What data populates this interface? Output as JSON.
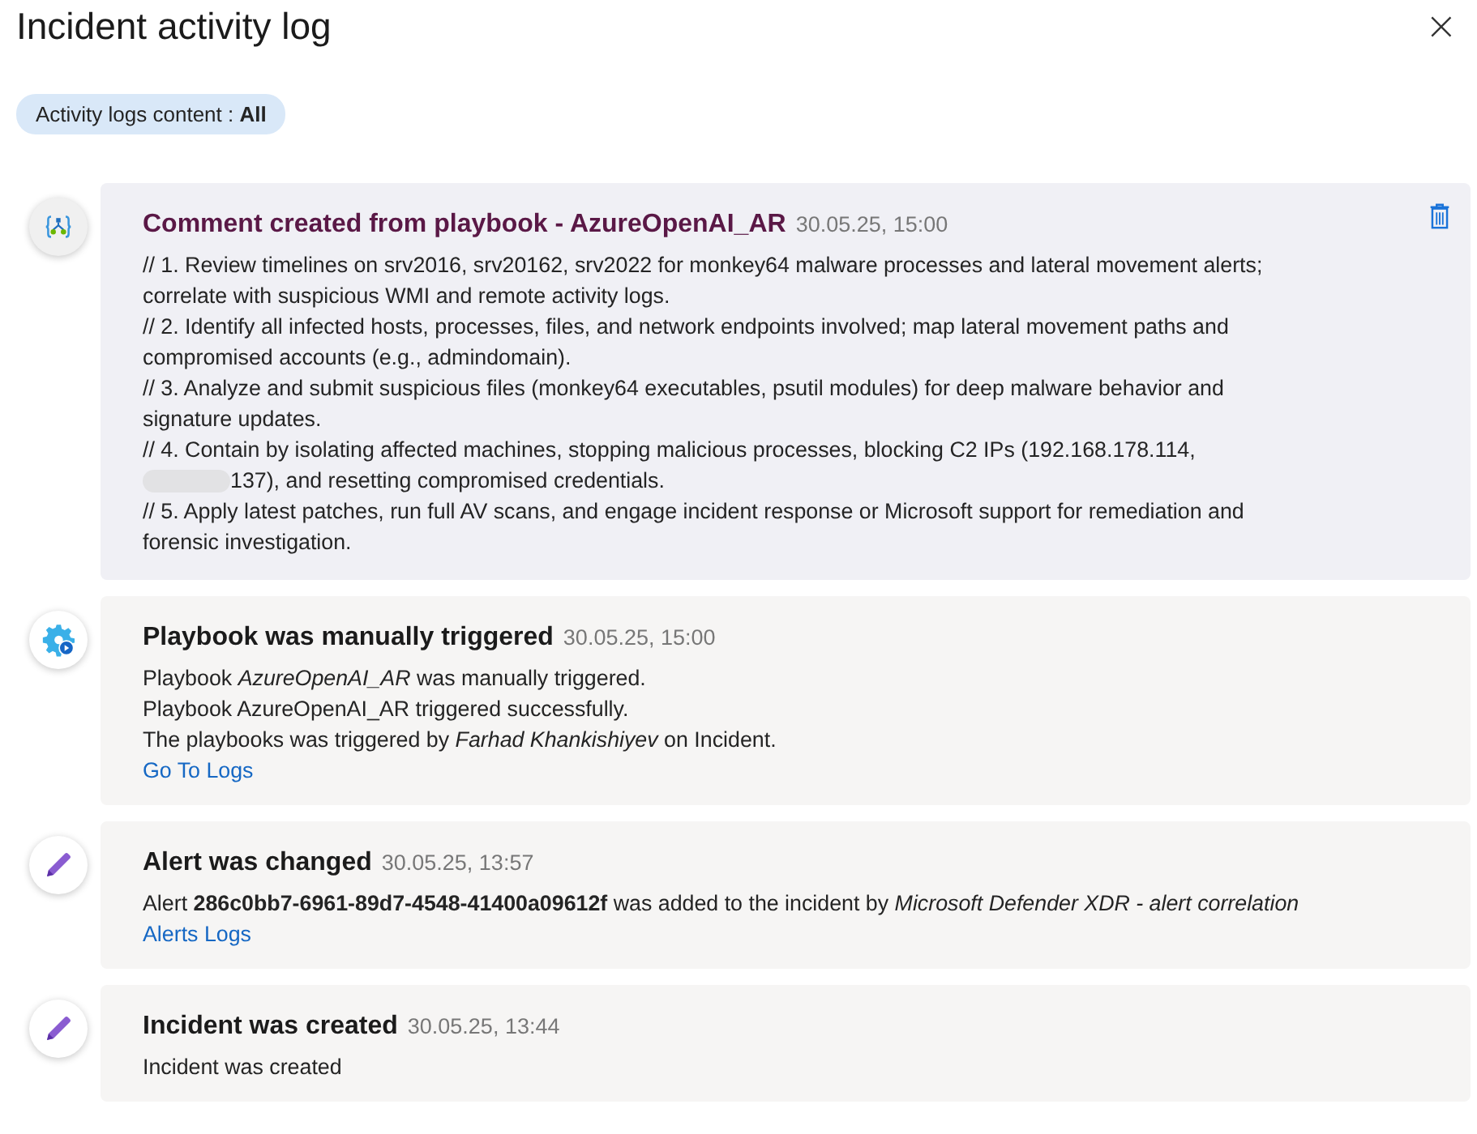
{
  "panel": {
    "title": "Incident activity log",
    "close": "×"
  },
  "filter": {
    "label": "Activity logs content : ",
    "value": "All"
  },
  "entries": [
    {
      "kind": "comment",
      "title": "Comment created from playbook - AzureOpenAI_AR",
      "time": "30.05.25, 15:00",
      "deletable": true,
      "lines": [
        {
          "text": "// 1. Review timelines on srv2016, srv20162, srv2022 for monkey64 malware processes and lateral movement alerts;"
        },
        {
          "text": "correlate with suspicious WMI and remote activity logs."
        },
        {
          "text": "// 2. Identify all infected hosts, processes, files, and network endpoints involved; map lateral movement paths and"
        },
        {
          "text": "compromised accounts (e.g., admindomain)."
        },
        {
          "text": "// 3. Analyze and submit suspicious files (monkey64 executables, psutil modules) for deep malware behavior and"
        },
        {
          "text": "signature updates."
        },
        {
          "text": "// 4. Contain by isolating affected machines, stopping malicious processes, blocking C2 IPs (192.168.178.114,"
        },
        {
          "text": "137), and resetting compromised credentials.",
          "redacted": true
        },
        {
          "text": "// 5. Apply latest patches, run full AV scans, and engage incident response or Microsoft support for remediation and"
        },
        {
          "text": "forensic investigation."
        }
      ]
    },
    {
      "kind": "automation",
      "title": "Playbook was manually triggered",
      "time": "30.05.25, 15:00",
      "deletable": false,
      "lines": [
        {
          "text": "Playbook *AzureOpenAI_AR* was manually triggered."
        },
        {
          "text": "Playbook AzureOpenAI_AR triggered successfully."
        },
        {
          "text": "The playbooks was triggered by *Farhad Khankishiyev* on Incident."
        }
      ],
      "link": "Go To Logs"
    },
    {
      "kind": "edit",
      "title": "Alert was changed",
      "time": "30.05.25, 13:57",
      "deletable": false,
      "lines": [
        {
          "text": "Alert **286c0bb7-6961-89d7-4548-41400a09612f** was added to the incident by *Microsoft Defender XDR - alert correlation*"
        }
      ],
      "link": "Alerts Logs"
    },
    {
      "kind": "edit",
      "title": "Incident was created",
      "time": "30.05.25, 13:44",
      "deletable": false,
      "lines": [
        {
          "text": "Incident was created"
        }
      ]
    }
  ]
}
